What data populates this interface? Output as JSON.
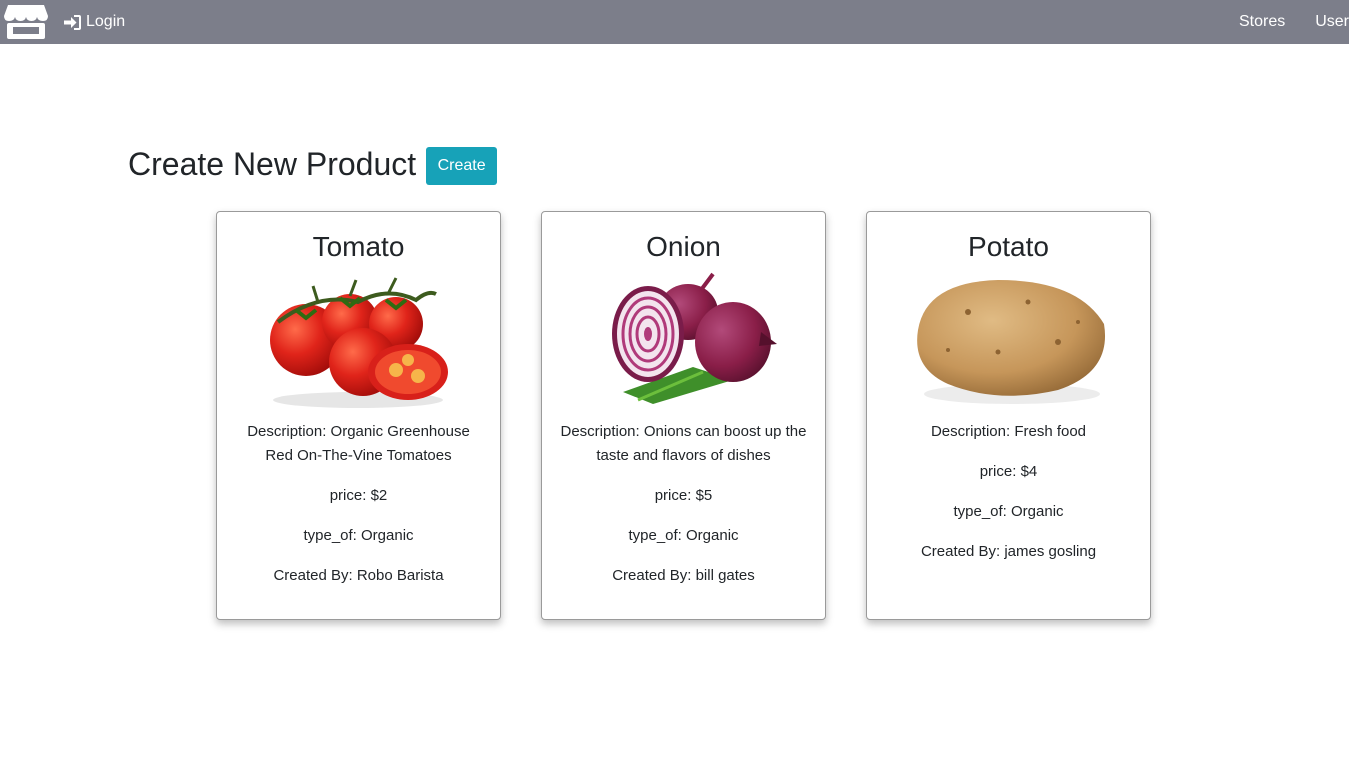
{
  "nav": {
    "brand_icon": "store-icon",
    "login_icon": "sign-in-icon",
    "login_label": "Login",
    "links": [
      "Stores",
      "Users"
    ]
  },
  "header": {
    "title": "Create New Product",
    "create_label": "Create"
  },
  "products": [
    {
      "name": "Tomato",
      "description": "Description: Organic Greenhouse Red On-The-Vine Tomatoes",
      "price": "price: $2",
      "type": "type_of: Organic",
      "created_by": "Created By: Robo Barista"
    },
    {
      "name": "Onion",
      "description": "Description: Onions can boost up the taste and flavors of dishes",
      "price": "price: $5",
      "type": "type_of: Organic",
      "created_by": "Created By: bill gates"
    },
    {
      "name": "Potato",
      "description": "Description: Fresh food",
      "price": "price: $4",
      "type": "type_of: Organic",
      "created_by": "Created By: james gosling"
    }
  ],
  "colors": {
    "navbar": "#7c7e8a",
    "create_button": "#17a2b8"
  }
}
